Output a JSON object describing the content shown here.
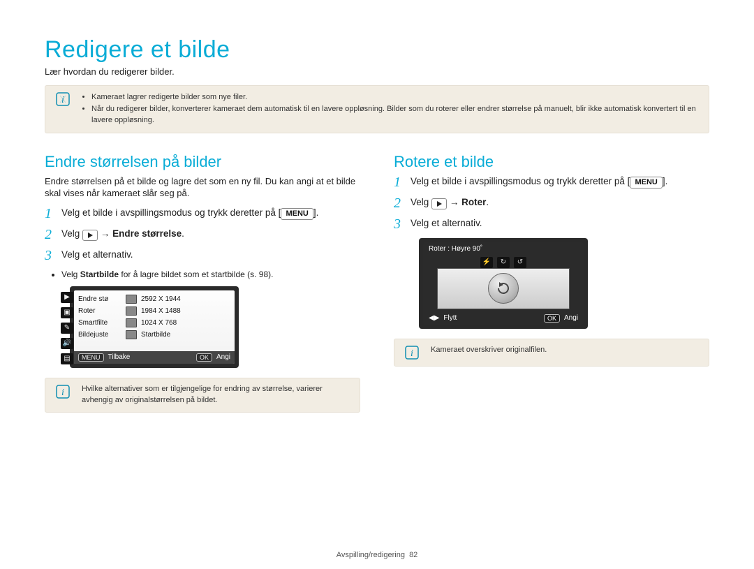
{
  "page": {
    "title": "Redigere et bilde",
    "subtitle": "Lær hvordan du redigerer bilder.",
    "footer_section": "Avspilling/redigering",
    "footer_page": "82"
  },
  "intro_box": {
    "bullets": [
      "Kameraet lagrer redigerte bilder som nye filer.",
      "Når du redigerer bilder, konverterer kameraet dem automatisk til en lavere oppløsning. Bilder som du roterer eller endrer størrelse på manuelt, blir ikke automatisk konvertert til en lavere oppløsning."
    ]
  },
  "resize": {
    "heading": "Endre størrelsen på bilder",
    "intro": "Endre størrelsen på et bilde og lagre det som en ny fil. Du kan angi at et bilde skal vises når kameraet slår seg på.",
    "steps": {
      "s1": "Velg et bilde i avspillingsmodus og trykk deretter på",
      "s1_after": ".",
      "s2_pre": "Velg",
      "s2_arrow": "→",
      "s2_bold": "Endre størrelse",
      "s2_after": ".",
      "s3": "Velg et alternativ."
    },
    "substeps": {
      "b1_pre": "Velg",
      "b1_bold": "Startbilde",
      "b1_post": "for å lagre bildet som et startbilde (s. 98)."
    },
    "menu_label": "MENU",
    "lcd": {
      "cols_left": [
        "Endre stø",
        "Roter",
        "Smartfilte",
        "Bildejuste"
      ],
      "cols_right": [
        "2592 X 1944",
        "1984 X 1488",
        "1024 X 768",
        "Startbilde"
      ],
      "footer_left_btn": "MENU",
      "footer_left": "Tilbake",
      "footer_right_btn": "OK",
      "footer_right": "Angi"
    },
    "note": "Hvilke alternativer som er tilgjengelige for endring av størrelse, varierer avhengig av originalstørrelsen på bildet."
  },
  "rotate": {
    "heading": "Rotere et bilde",
    "steps": {
      "s1": "Velg et bilde i avspillingsmodus og trykk deretter på",
      "s1_after": ".",
      "s2_pre": "Velg",
      "s2_arrow": "→",
      "s2_bold": "Roter",
      "s2_after": ".",
      "s3": "Velg et alternativ."
    },
    "menu_label": "MENU",
    "lcd": {
      "title": "Roter : Høyre 90˚",
      "footer_left": "Flytt",
      "footer_right_btn": "OK",
      "footer_right": "Angi"
    },
    "note": "Kameraet overskriver originalfilen."
  }
}
